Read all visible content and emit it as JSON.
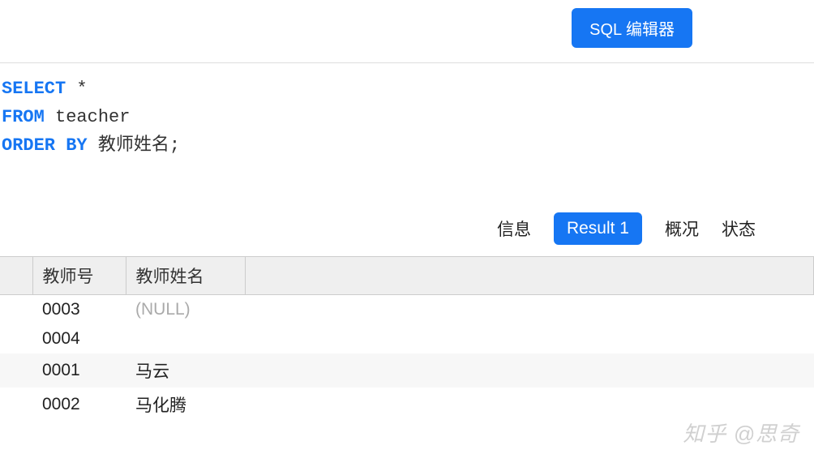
{
  "toolbar": {
    "sql_editor_button": "SQL 编辑器"
  },
  "code": {
    "kw_select": "SELECT",
    "star": " *",
    "kw_from": "FROM",
    "table_name": " teacher",
    "kw_orderby": "ORDER BY",
    "column": " 教师姓名;"
  },
  "tabs": {
    "info": "信息",
    "result": "Result 1",
    "profile": "概况",
    "status": "状态"
  },
  "table": {
    "headers": {
      "col1": "教师号",
      "col2": "教师姓名"
    },
    "rows": [
      {
        "id": "0003",
        "name": "(NULL)",
        "is_null": true
      },
      {
        "id": "0004",
        "name": ""
      },
      {
        "id": "0001",
        "name": "马云"
      },
      {
        "id": "0002",
        "name": "马化腾"
      }
    ]
  },
  "watermark": "知乎 @思奇"
}
